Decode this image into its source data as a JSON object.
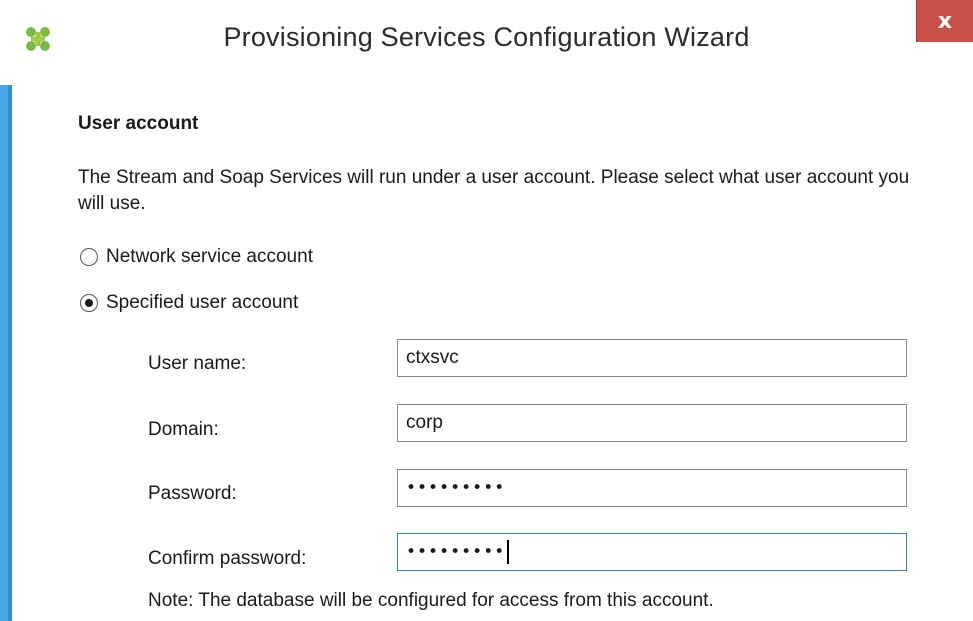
{
  "window": {
    "title": "Provisioning Services Configuration Wizard",
    "close_glyph": "x",
    "icon": "citrix-app-icon"
  },
  "section": {
    "heading": "User account",
    "description": "The Stream and Soap Services will run under a user account. Please select what user account you will use."
  },
  "account_options": [
    {
      "label": "Network service account",
      "selected": false
    },
    {
      "label": "Specified user account",
      "selected": true
    }
  ],
  "fields": {
    "username": {
      "label": "User name:",
      "value": "ctxsvc"
    },
    "domain": {
      "label": "Domain:",
      "value": "corp"
    },
    "password": {
      "label": "Password:",
      "value": "•••••••••"
    },
    "confirm_password": {
      "label": "Confirm password:",
      "value": "•••••••••"
    }
  },
  "note": "Note: The database will be configured for access from this account.",
  "colors": {
    "close_button": "#c7504a",
    "window_border": "#4aa6e6",
    "focus_border": "#3c7fb1"
  }
}
